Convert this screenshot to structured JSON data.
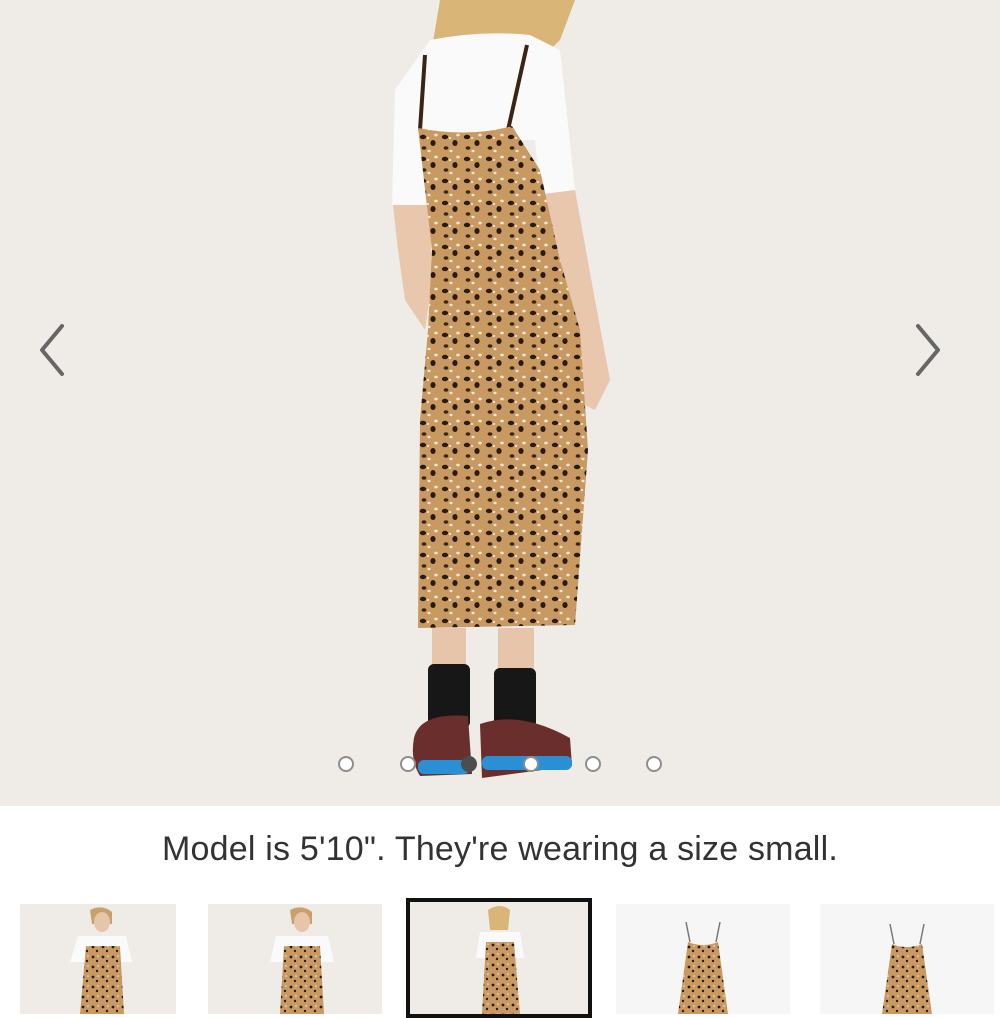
{
  "gallery": {
    "image_alt": "Model wearing leopard print slip dress, back view",
    "prev_icon": "chevron-left-icon",
    "next_icon": "chevron-right-icon",
    "slide_count": 5,
    "active_index": 2
  },
  "caption": "Model is 5'10\". They're wearing a size small.",
  "thumbnails": [
    {
      "view": "model-front"
    },
    {
      "view": "model-front"
    },
    {
      "view": "model-back",
      "selected": true
    },
    {
      "view": "product-flat"
    },
    {
      "view": "product-flat"
    }
  ],
  "colors": {
    "background": "#efebe7",
    "active_dot": "#4d4d4d",
    "selected_border": "#111111"
  }
}
